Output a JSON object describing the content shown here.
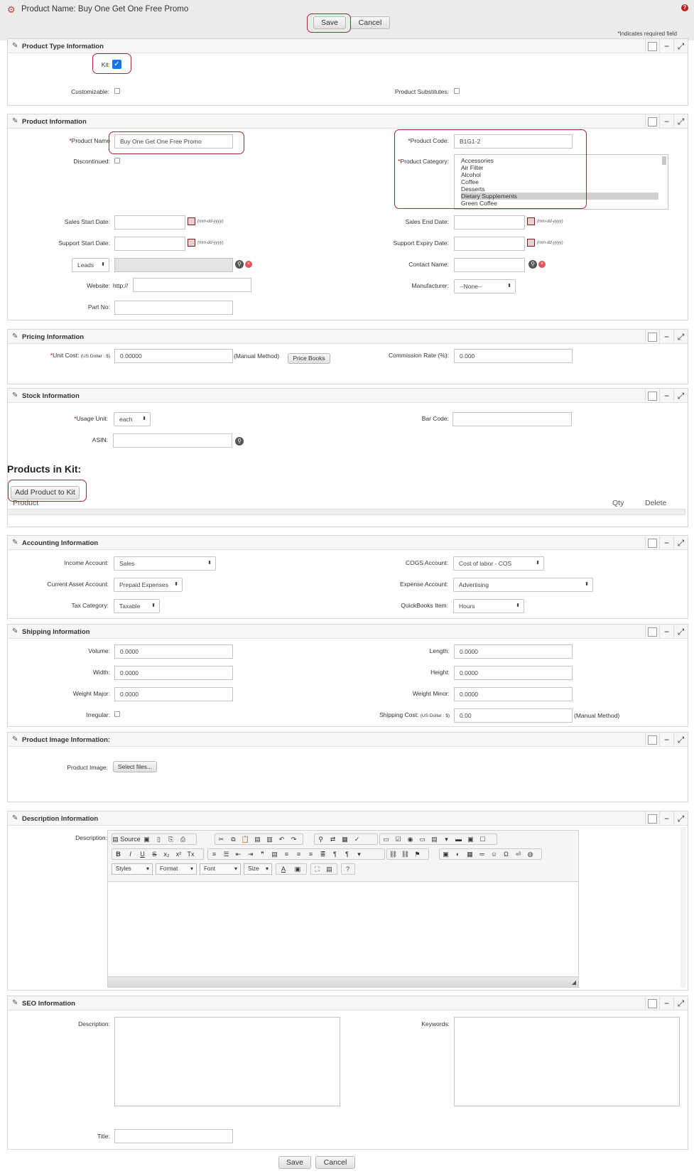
{
  "header": {
    "title": "Product Name: Buy One Get One Free Promo",
    "save": "Save",
    "cancel": "Cancel",
    "required_note": "*Indicates required field",
    "help_icon": "?"
  },
  "panel_icons": {
    "minimize": "−",
    "maximize": "⤢",
    "edit": "✎"
  },
  "product_type": {
    "title": "Product Type Information",
    "kit_label": "Kit:",
    "kit_checked": true,
    "customizable_label": "Customizable:",
    "substitutes_label": "Product Substitutes:"
  },
  "product_info": {
    "title": "Product Information",
    "name_label": "Product Name",
    "name_value": "Buy One Get One Free Promo",
    "code_label": "Product Code:",
    "code_value": "B1G1-2",
    "discontinued_label": "Discontinued:",
    "category_label": "Product Category:",
    "categories": [
      "Accessories",
      "Air Filter",
      "Alcohol",
      "Coffee",
      "Desserts",
      "Dietary Supplements",
      "Green Coffee"
    ],
    "selected_category": "Dietary Supplements",
    "sales_start_label": "Sales Start Date:",
    "sales_end_label": "Sales End Date:",
    "support_start_label": "Support Start Date:",
    "support_expiry_label": "Support Expiry Date:",
    "date_hint": "(mm-dd-yyyy)",
    "leads_value": "Leads",
    "contact_label": "Contact Name:",
    "website_label": "Website:",
    "website_prefix": "http://",
    "manufacturer_label": "Manufacturer:",
    "manufacturer_value": "--None--",
    "part_label": "Part No:"
  },
  "pricing": {
    "title": "Pricing Information",
    "unit_cost_label": "Unit Cost:",
    "currency": "(US Dollar : $)",
    "unit_cost_value": "0.00000",
    "manual": "(Manual Method)",
    "price_books": "Price Books",
    "commission_label": "Commission Rate (%):",
    "commission_value": "0.000"
  },
  "stock": {
    "title": "Stock Information",
    "usage_label": "Usage Unit:",
    "usage_value": "each",
    "barcode_label": "Bar Code:",
    "asin_label": "ASIN:"
  },
  "kit": {
    "heading": "Products in Kit:",
    "add_button": "Add Product to Kit",
    "col_product": "Product",
    "col_qty": "Qty",
    "col_delete": "Delete"
  },
  "accounting": {
    "title": "Accounting Information",
    "income_label": "Income Account:",
    "income_value": "Sales",
    "cogs_label": "COGS Account:",
    "cogs_value": "Cost of labor - COS",
    "asset_label": "Current Asset Account:",
    "asset_value": "Prepaid Expenses",
    "expense_label": "Expense Account:",
    "expense_value": "Advertising",
    "tax_label": "Tax Category:",
    "tax_value": "Taxable",
    "qb_label": "QuickBooks Item:",
    "qb_value": "Hours"
  },
  "shipping": {
    "title": "Shipping Information",
    "volume_label": "Volume:",
    "volume_value": "0.0000",
    "length_label": "Length:",
    "length_value": "0.0000",
    "width_label": "Width:",
    "width_value": "0.0000",
    "height_label": "Height:",
    "height_value": "0.0000",
    "wmajor_label": "Weight Major:",
    "wmajor_value": "0.0000",
    "wminor_label": "Weight Minor:",
    "wminor_value": "0.0000",
    "irregular_label": "Irregular:",
    "cost_label": "Shipping Cost:",
    "currency": "(US Dollar : $)",
    "cost_value": "0.00",
    "manual": "(Manual Method)"
  },
  "image": {
    "title": "Product Image Information:",
    "label": "Product Image:",
    "button": "Select files..."
  },
  "description": {
    "title": "Description Information",
    "label": "Description:",
    "source": "Source",
    "styles": "Styles",
    "format": "Format",
    "font": "Font",
    "size": "Size"
  },
  "seo": {
    "title": "SEO Information",
    "description_label": "Description:",
    "keywords_label": "Keywords:",
    "title_label": "Title:"
  },
  "footer": {
    "save": "Save",
    "cancel": "Cancel"
  }
}
